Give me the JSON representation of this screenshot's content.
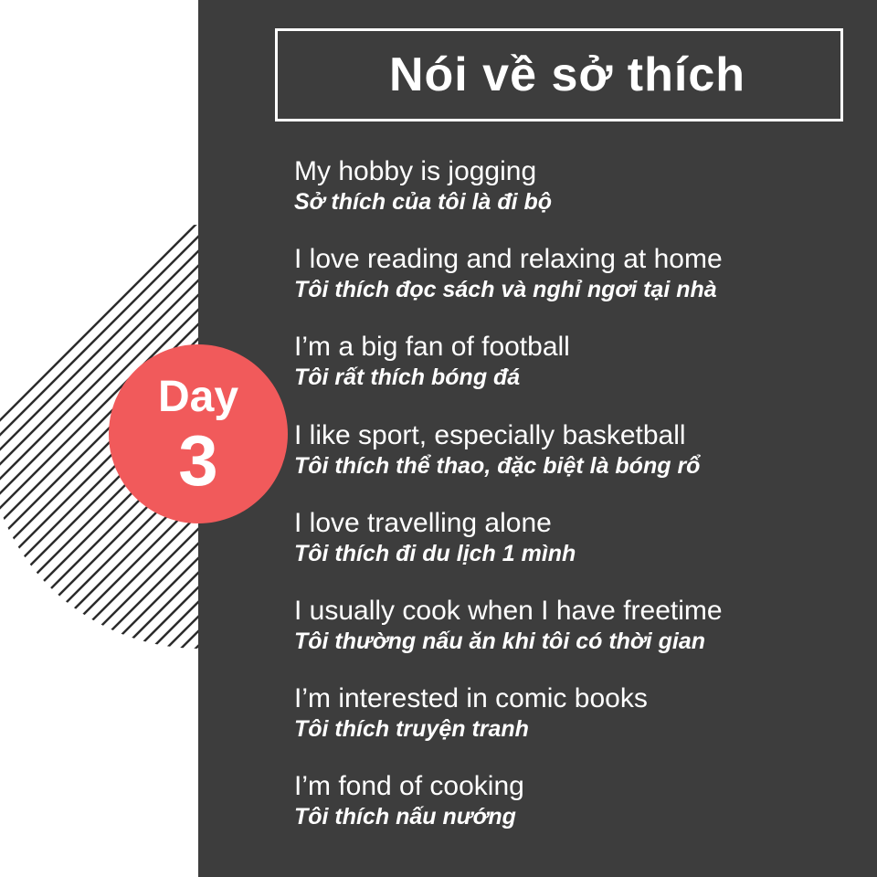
{
  "title": "Nói về sở thích",
  "badge": {
    "word": "Day",
    "number": "3"
  },
  "phrases": [
    {
      "en": "My hobby is jogging",
      "vi": "Sở thích của tôi là đi bộ"
    },
    {
      "en": "I love reading and relaxing at home",
      "vi": "Tôi thích đọc sách và nghỉ ngơi tại nhà"
    },
    {
      "en": "I’m a big fan of football",
      "vi": "Tôi rất thích bóng đá"
    },
    {
      "en": "I like sport, especially basketball",
      "vi": "Tôi thích thể thao, đặc biệt là bóng rổ"
    },
    {
      "en": "I love travelling alone",
      "vi": "Tôi thích đi du lịch 1 mình"
    },
    {
      "en": "I usually cook when I have freetime",
      "vi": "Tôi thường nấu ăn khi tôi có thời gian"
    },
    {
      "en": "I’m interested in comic books",
      "vi": "Tôi thích truyện tranh"
    },
    {
      "en": "I’m fond of cooking",
      "vi": "Tôi thích nấu nướng"
    }
  ],
  "colors": {
    "panel": "#3d3d3d",
    "badge": "#f15a5b",
    "text": "#ffffff",
    "stripes": "#2b2b2b"
  }
}
